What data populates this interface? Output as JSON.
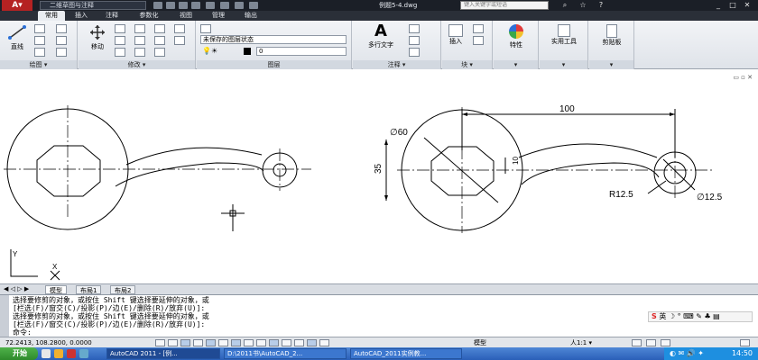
{
  "titlebar": {
    "workspace": "二维草图与注释",
    "document_title": "例题5-4.dwg",
    "search_placeholder": "键入关键字或短语"
  },
  "tabs": [
    "常用",
    "插入",
    "注释",
    "参数化",
    "视图",
    "管理",
    "输出"
  ],
  "active_tab": "常用",
  "ribbon": {
    "draw": {
      "line": "直线",
      "label": "绘图 ▾"
    },
    "modify": {
      "move": "移动",
      "label": "修改 ▾"
    },
    "layers": {
      "state": "未保存的图层状态",
      "current": "0",
      "label": "图层"
    },
    "annotation": {
      "mtext": "多行文字",
      "label": "注释 ▾"
    },
    "block": {
      "insert": "插入",
      "label": "块 ▾"
    },
    "properties": {
      "label": "特性"
    },
    "utilities": {
      "label": "实用工具"
    },
    "clipboard": {
      "label": "剪贴板"
    }
  },
  "drawing": {
    "dims": {
      "length": "100",
      "diameter": "∅60",
      "height": "35",
      "gap": "10",
      "radius": "R12.5",
      "small_diameter": "∅12.5"
    },
    "ucs": {
      "x": "X",
      "y": "Y"
    }
  },
  "layout_tabs": [
    "模型",
    "布局1",
    "布局2"
  ],
  "active_layout": "模型",
  "command": {
    "lines": [
      "选择要修剪的对象，或按住 Shift 键选择要延伸的对象，或",
      "[栏选(F)/窗交(C)/投影(P)/边(E)/删除(R)/放弃(U)]:",
      "选择要修剪的对象，或按住 Shift 键选择要延伸的对象，或",
      "[栏选(F)/窗交(C)/投影(P)/边(E)/删除(R)/放弃(U)]:",
      "命令:"
    ],
    "ime": "英"
  },
  "statusbar": {
    "coords": "72.2413, 108.2800, 0.0000",
    "model": "模型",
    "scale": "人1:1 ▾"
  },
  "taskbar": {
    "start": "开始",
    "tasks": [
      "AutoCAD 2011 - [例...",
      "D:\\2011书\\AutoCAD_2...",
      "AutoCAD_2011实例教..."
    ],
    "clock": "14:50"
  },
  "colors": {
    "accent": "#2a5fb8",
    "titlebar": "#1b1f27",
    "ribbon": "#e6e9ee",
    "drawing_bg": "#ffffff"
  }
}
